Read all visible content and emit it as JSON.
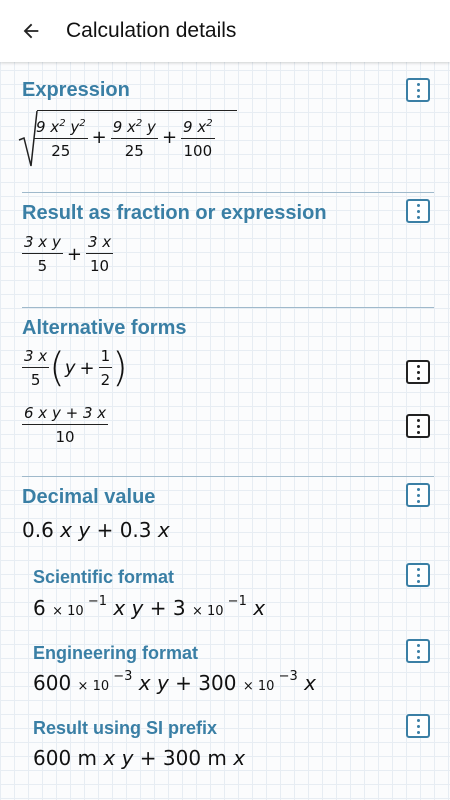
{
  "header": {
    "title": "Calculation details",
    "back_icon": "arrow-left-icon"
  },
  "expression": {
    "title": "Expression",
    "frac1": {
      "num": "9 x² y²",
      "den": "25"
    },
    "frac2": {
      "num": "9 x² y",
      "den": "25"
    },
    "frac3": {
      "num": "9 x²",
      "den": "100"
    },
    "plus": "+"
  },
  "result": {
    "title": "Result as fraction or expression",
    "frac1": {
      "num": "3 x y",
      "den": "5"
    },
    "frac2": {
      "num": "3 x",
      "den": "10"
    },
    "plus": "+"
  },
  "alternative": {
    "title": "Alternative forms",
    "form1": {
      "coef_num": "3 x",
      "coef_den": "5",
      "inner_var": "y",
      "plus": "+",
      "half_num": "1",
      "half_den": "2"
    },
    "form2": {
      "num": "6 x y + 3 x",
      "den": "10"
    }
  },
  "decimal": {
    "title": "Decimal value",
    "value": "0.6 x y + 0.3 x",
    "scientific": {
      "title": "Scientific format",
      "value": "6 × 10 −1 x y + 3 × 10 −1 x"
    },
    "engineering": {
      "title": "Engineering format",
      "value": "600 × 10 −3 x y + 300 × 10 −3 x"
    },
    "si_prefix": {
      "title": "Result using SI prefix",
      "value": "600 m x y + 300 m x"
    }
  },
  "colors": {
    "accent": "#3a7fa5",
    "divider": "#9fb9cb",
    "grid": "#e7edf3"
  }
}
